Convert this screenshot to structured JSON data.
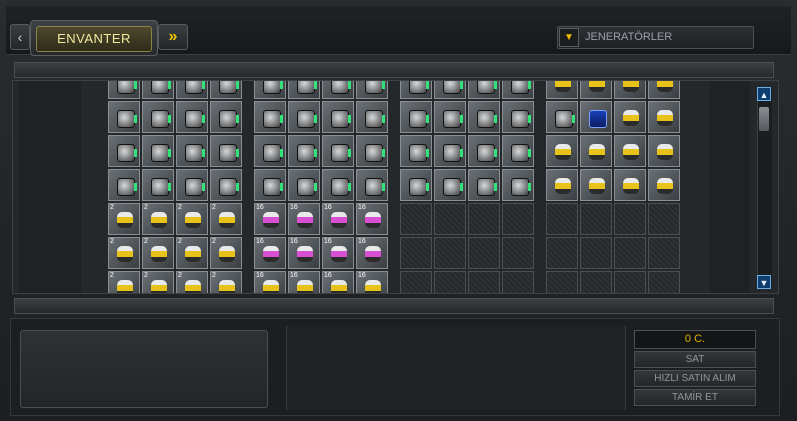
{
  "header": {
    "prev_symbol": "‹",
    "tab_title": "ENVANTER",
    "next_symbol": "»"
  },
  "filter": {
    "arrow": "▼",
    "selected": "JENERATÖRLER"
  },
  "inventory": {
    "sections": [
      {
        "cols": 4,
        "rows": [
          "gen",
          "gen",
          "gen",
          "gen",
          "yel",
          "yel",
          "gen2"
        ]
      },
      {
        "cols": 4,
        "rows": [
          "gen",
          "gen",
          "gen",
          "gen",
          "pnk",
          "pnk",
          "gen2"
        ]
      },
      {
        "cols": 4,
        "rows": [
          "gen",
          "gen",
          "gen",
          "gen",
          "empty",
          "empty",
          "empty"
        ]
      },
      {
        "cols": 4,
        "rows": [
          "yel",
          "special",
          "yel",
          "yel",
          "empty",
          "empty",
          "empty"
        ]
      }
    ],
    "level_labels": [
      "2",
      "16"
    ]
  },
  "scrollbar": {
    "up": "▲",
    "down": "▼"
  },
  "actions": {
    "money": "0 C.",
    "sell": "SAT",
    "quick_buy": "HIZLI SATIN ALIM",
    "repair": "TAMİR ET"
  }
}
